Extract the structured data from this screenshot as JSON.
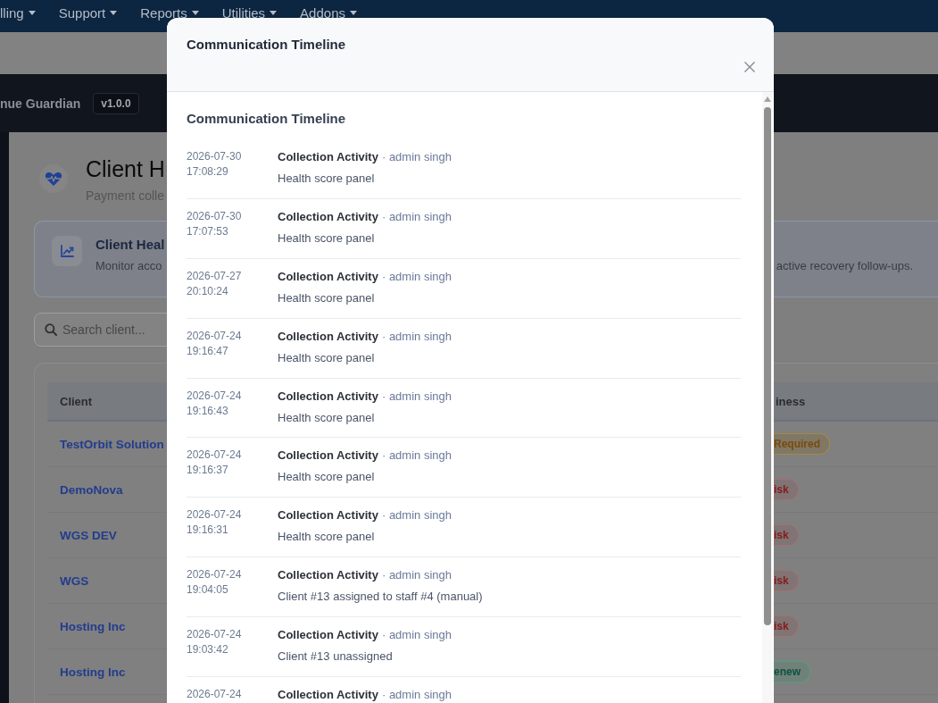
{
  "top_nav": {
    "items": [
      {
        "label": "lling"
      },
      {
        "label": "Support"
      },
      {
        "label": "Reports"
      },
      {
        "label": "Utilities"
      },
      {
        "label": "Addons"
      }
    ]
  },
  "brand_bar": {
    "name": "nue Guardian",
    "version": "v1.0.0"
  },
  "page_header": {
    "title": "Client H",
    "subtitle": "Payment colle"
  },
  "info_card": {
    "title": "Client Heal",
    "description_parts": [
      "Monitor acco",
      "active recovery follow-ups."
    ]
  },
  "search": {
    "placeholder": "Search client..."
  },
  "table": {
    "columns": [
      "Client",
      "iness"
    ],
    "rows": [
      {
        "client": "TestOrbit Solution",
        "badge": {
          "label": "Required",
          "kind": "warning"
        }
      },
      {
        "client": "DemoNova",
        "badge": {
          "label": "isk",
          "kind": "danger"
        }
      },
      {
        "client": "WGS DEV",
        "badge": {
          "label": "isk",
          "kind": "danger"
        }
      },
      {
        "client": "WGS",
        "badge": {
          "label": "isk",
          "kind": "danger"
        }
      },
      {
        "client": "Hosting Inc",
        "badge": {
          "label": "isk",
          "kind": "danger"
        }
      },
      {
        "client": "Hosting Inc",
        "badge": {
          "label": "enew",
          "kind": "success"
        }
      }
    ]
  },
  "modal": {
    "title": "Communication Timeline",
    "section_title": "Communication Timeline",
    "entries": [
      {
        "date": "2026-07-30",
        "time": "17:08:29",
        "title": "Collection Activity",
        "meta": "· admin singh",
        "detail": "Health score panel"
      },
      {
        "date": "2026-07-30",
        "time": "17:07:53",
        "title": "Collection Activity",
        "meta": "· admin singh",
        "detail": "Health score panel"
      },
      {
        "date": "2026-07-27",
        "time": "20:10:24",
        "title": "Collection Activity",
        "meta": "· admin singh",
        "detail": "Health score panel"
      },
      {
        "date": "2026-07-24",
        "time": "19:16:47",
        "title": "Collection Activity",
        "meta": "· admin singh",
        "detail": "Health score panel"
      },
      {
        "date": "2026-07-24",
        "time": "19:16:43",
        "title": "Collection Activity",
        "meta": "· admin singh",
        "detail": "Health score panel"
      },
      {
        "date": "2026-07-24",
        "time": "19:16:37",
        "title": "Collection Activity",
        "meta": "· admin singh",
        "detail": "Health score panel"
      },
      {
        "date": "2026-07-24",
        "time": "19:16:31",
        "title": "Collection Activity",
        "meta": "· admin singh",
        "detail": "Health score panel"
      },
      {
        "date": "2026-07-24",
        "time": "19:04:05",
        "title": "Collection Activity",
        "meta": "· admin singh",
        "detail": "Client #13 assigned to staff #4 (manual)"
      },
      {
        "date": "2026-07-24",
        "time": "19:03:42",
        "title": "Collection Activity",
        "meta": "· admin singh",
        "detail": "Client #13 unassigned"
      },
      {
        "date": "2026-07-24",
        "title": "Collection Activity",
        "meta": "· admin singh"
      }
    ]
  }
}
